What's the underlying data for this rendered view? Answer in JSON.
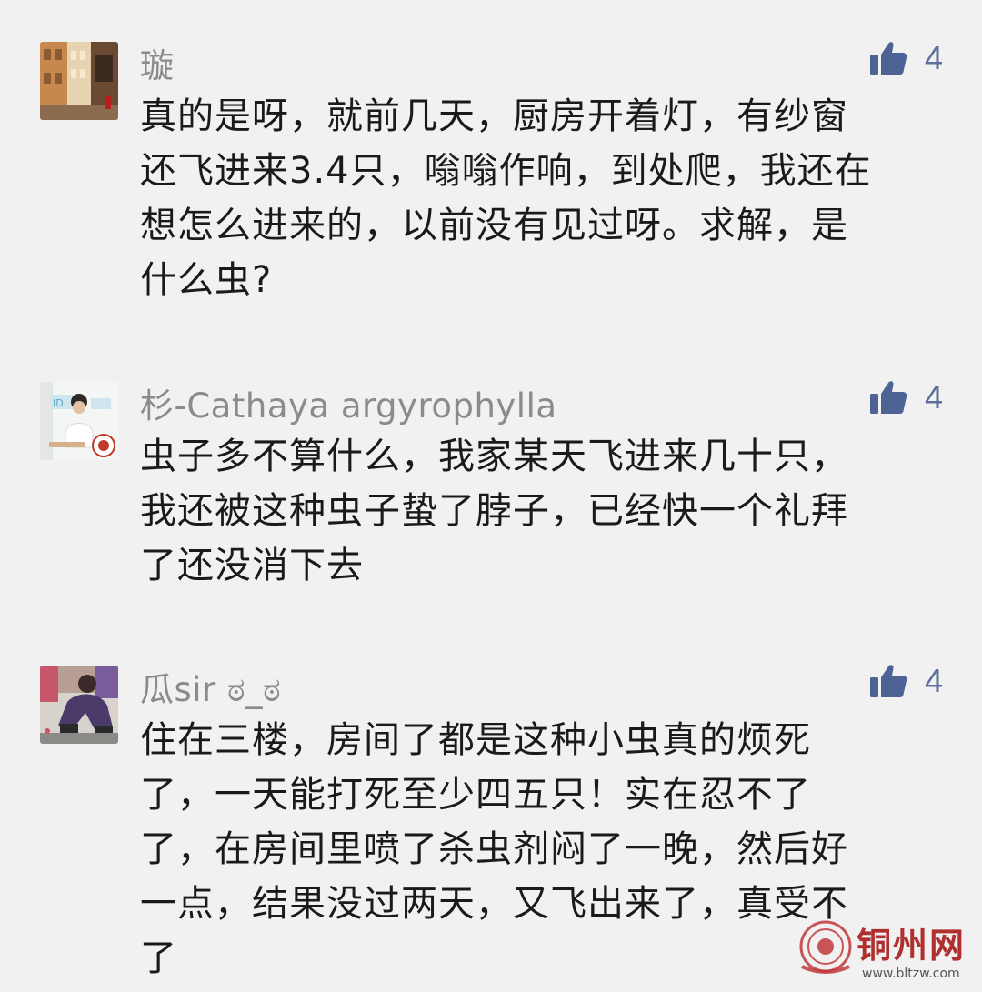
{
  "comments": [
    {
      "username": "璇",
      "likes": "4",
      "lines": [
        "真的是呀，就前几天，厨房开着灯，有纱窗",
        "还飞进来3.4只，嗡嗡作响，到处爬，我还在",
        "想怎么进来的，以前没有见过呀。求解，是",
        "什么虫?"
      ]
    },
    {
      "username": "杉-Cathaya argyrophylla",
      "likes": "4",
      "lines": [
        "虫子多不算什么，我家某天飞进来几十只，",
        "我还被这种虫子蛰了脖子，已经快一个礼拜",
        "了还没消下去"
      ]
    },
    {
      "username": "瓜sir ಠ_ಠ",
      "likes": "4",
      "lines": [
        "住在三楼，房间了都是这种小虫真的烦死",
        "了，一天能打死至少四五只！实在忍不了",
        "了，在房间里喷了杀虫剂闷了一晚，然后好",
        "一点，结果没过两天，又飞出来了，真受不",
        "了"
      ]
    }
  ],
  "watermark": {
    "title": "铜州网",
    "url": "www.bltzw.com"
  },
  "colors": {
    "background": "#f1f1f1",
    "username": "#8b8b8b",
    "like_icon": "#4d6396",
    "body_text": "#1a1a1a",
    "watermark": "#b03030"
  },
  "icons": {
    "like": "thumbs-up-icon"
  }
}
